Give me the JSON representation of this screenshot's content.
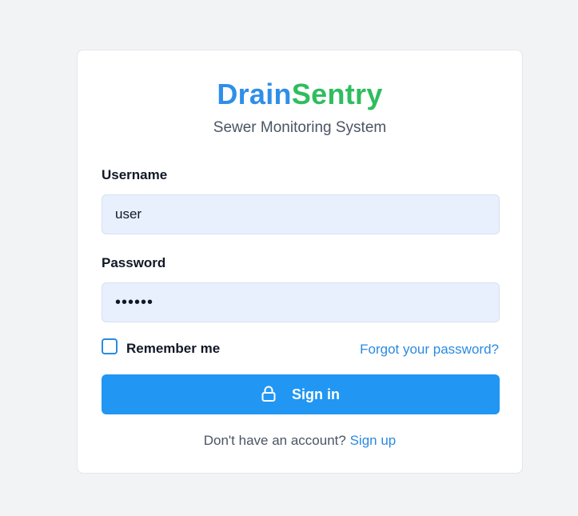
{
  "brand": {
    "part1": "Drain",
    "part2": "Sentry",
    "color1": "#2f8fe8",
    "color2": "#2fbd5e"
  },
  "subtitle": "Sewer Monitoring System",
  "form": {
    "username_label": "Username",
    "username_value": "user",
    "password_label": "Password",
    "password_value": "••••••",
    "remember_label": "Remember me",
    "remember_checked": false,
    "forgot_link": "Forgot your password?",
    "signin_label": "Sign in",
    "signin_icon": "lock-icon"
  },
  "footer": {
    "prompt": "Don't have an account?",
    "signup_link": "Sign up"
  },
  "colors": {
    "accent": "#2196f3",
    "link": "#2b8ae0",
    "input_bg": "#e8f0fd"
  }
}
